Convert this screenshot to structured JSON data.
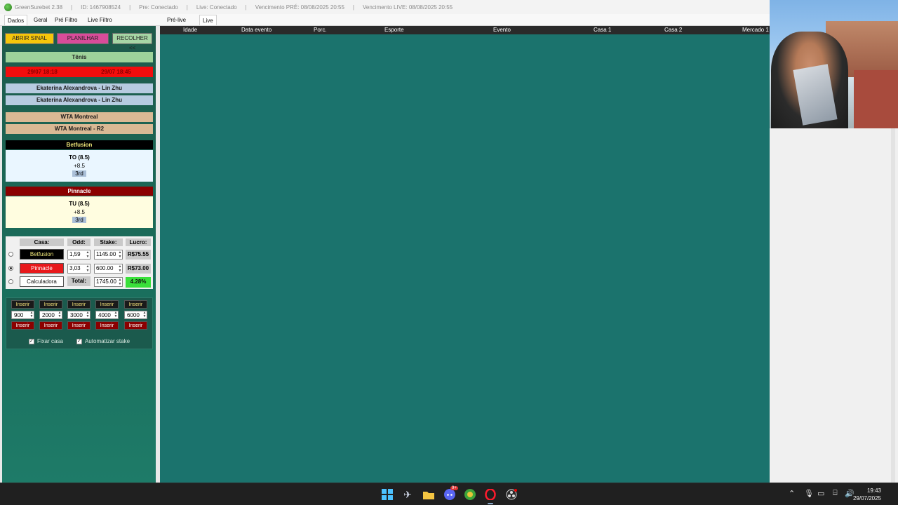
{
  "titlebar": {
    "app_name": "GreenSurebet 2.38",
    "id": "ID: 1467908524",
    "pre_status": "Pre: Conectado",
    "live_status": "Live: Conectado",
    "venc_pre": "Vencimento PRÉ: 08/08/2025 20:55",
    "venc_live": "Vencimento LIVE: 08/08/2025 20:55",
    "separator": "|"
  },
  "tabs": {
    "left": [
      "Dados",
      "Geral",
      "Pré Filtro",
      "Live Filtro"
    ],
    "right": [
      "Pré-live",
      "Live"
    ]
  },
  "left_panel": {
    "buttons": {
      "abrir": "ABRIR SINAL",
      "planilhar": "PLANILHAR",
      "recolher": "RECOLHER <<"
    },
    "sport": "Tênis",
    "time_left": "29/07 18:18",
    "time_right": "29/07 18:45",
    "event1": "Ekaterina Alexandrova - Lin Zhu",
    "event2": "Ekaterina Alexandrova - Lin Zhu",
    "league1": "WTA Montreal",
    "league2": "WTA Montreal - R2",
    "house1": {
      "name": "Betfusion",
      "market": "TO (8.5)",
      "line": "+8.5",
      "period": "3rd"
    },
    "house2": {
      "name": "Pinnacle",
      "market": "TU (8.5)",
      "line": "+8.5",
      "period": "3rd"
    }
  },
  "calculator": {
    "headers": {
      "casa": "Casa:",
      "odd": "Odd:",
      "stake": "Stake:",
      "lucro": "Lucro:"
    },
    "rows": [
      {
        "house": "Betfusion",
        "odd": "1,59",
        "stake": "1145.00",
        "profit": "R$75.55"
      },
      {
        "house": "Pinnacle",
        "odd": "3,03",
        "stake": "600.00",
        "profit": "R$73.00"
      }
    ],
    "calc_label": "Calculadora",
    "total_label": "Total:",
    "total_stake": "1745.00",
    "percent": "4.28%",
    "selected_row": 2
  },
  "stakes": {
    "insert_label": "Inserir",
    "values": [
      "900",
      "2000",
      "3000",
      "4000",
      "6000"
    ],
    "fixar": "Fixar casa",
    "automatizar": "Automatizar stake"
  },
  "grid": {
    "columns": [
      "Idade",
      "Data evento",
      "Porc.",
      "Esporte",
      "Evento",
      "Casa 1",
      "Casa 2",
      "Mercado 1"
    ]
  },
  "taskbar": {
    "time": "19:43",
    "date": "29/07/2025",
    "discord_badge": "9+"
  },
  "colors": {
    "grid_bg": "#1b736d",
    "left_panel_bg": "#1a6e5c",
    "accent_yellow": "#f6c60a",
    "accent_pink": "#d94c9a",
    "profit_green": "#39e03a"
  }
}
